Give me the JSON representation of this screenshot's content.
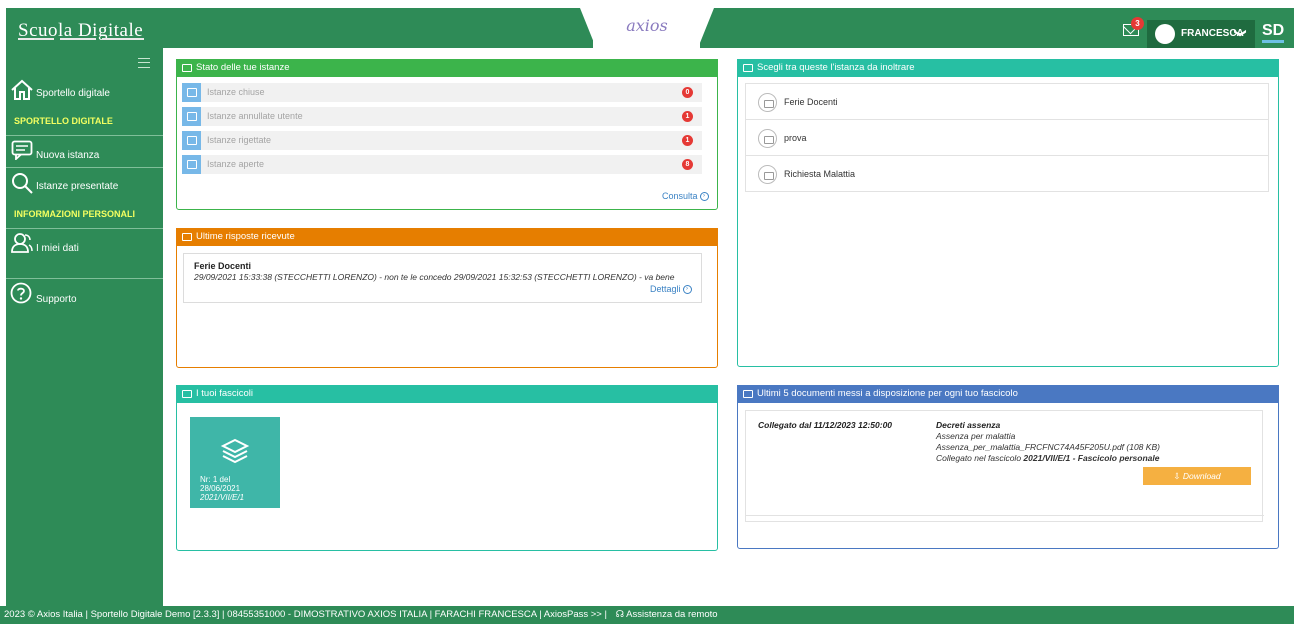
{
  "header": {
    "brand_title": "Scuola Digitale",
    "axios_logo": "axios",
    "mail_badge": "3",
    "user_name": "FRANCESCA",
    "user_chevron": "❯",
    "sd_logo": "SD"
  },
  "sidebar": {
    "items": [
      {
        "label": "Sportello digitale",
        "icon": "home-icon"
      },
      {
        "label": "Nuova istanza",
        "icon": "chat-icon"
      },
      {
        "label": "Istanze presentate",
        "icon": "search-icon"
      },
      {
        "label": "I miei dati",
        "icon": "users-icon"
      },
      {
        "label": "Supporto",
        "icon": "help-icon"
      }
    ],
    "sections": [
      "SPORTELLO DIGITALE",
      "INFORMAZIONI PERSONALI"
    ]
  },
  "stato": {
    "title": "Stato delle tue istanze",
    "rows": [
      {
        "label": "Istanze chiuse",
        "count": "0"
      },
      {
        "label": "Istanze annullate utente",
        "count": "1"
      },
      {
        "label": "Istanze rigettate",
        "count": "1"
      },
      {
        "label": "Istanze aperte",
        "count": "8"
      }
    ],
    "link": "Consulta"
  },
  "scegli": {
    "title": "Scegli tra queste l'istanza da inoltrare",
    "items": [
      "Ferie Docenti",
      "prova",
      "Richiesta Malattia"
    ]
  },
  "risposte": {
    "title": "Ultime risposte ricevute",
    "item_title": "Ferie Docenti",
    "item_text": "29/09/2021 15:33:38 (STECCHETTI LORENZO) - non te le concedo 29/09/2021 15:32:53 (STECCHETTI LORENZO) - va bene",
    "link": "Dettagli"
  },
  "fascicoli": {
    "title": "I tuoi fascicoli",
    "card_line1": "Nr: 1 del",
    "card_line2": "28/06/2021",
    "card_line3": "2021/VII/E/1"
  },
  "documenti": {
    "title": "Ultimi 5 documenti messi a disposizione per ogni tuo fascicolo",
    "collegato": "Collegato dal 11/12/2023 12:50:00",
    "doc_title": "Decreti assenza",
    "doc_line1": "Assenza per malattia",
    "doc_line2": "Assenza_per_malattia_FRCFNC74A45F205U.pdf (108 KB)",
    "doc_line3_prefix": "Collegato nel fascicolo ",
    "doc_line3_bold": "2021/VII/E/1 - Fascicolo personale",
    "download": "Download"
  },
  "footer": {
    "text": "2023 © Axios Italia |  Sportello Digitale Demo [2.3.3] |  08455351000 - DIMOSTRATIVO AXIOS ITALIA |  FARACHI FRANCESCA |  AxiosPass >> |",
    "assist": "Assistenza da remoto"
  },
  "colors": {
    "brand_green": "#2e8b57",
    "panel_green": "#3cb44b",
    "panel_orange": "#e67e00",
    "panel_teal": "#27bfa3",
    "panel_blue": "#4a78c2",
    "badge_red": "#e53935",
    "download_orange": "#f5b041",
    "section_yellow": "#f4ff60"
  }
}
